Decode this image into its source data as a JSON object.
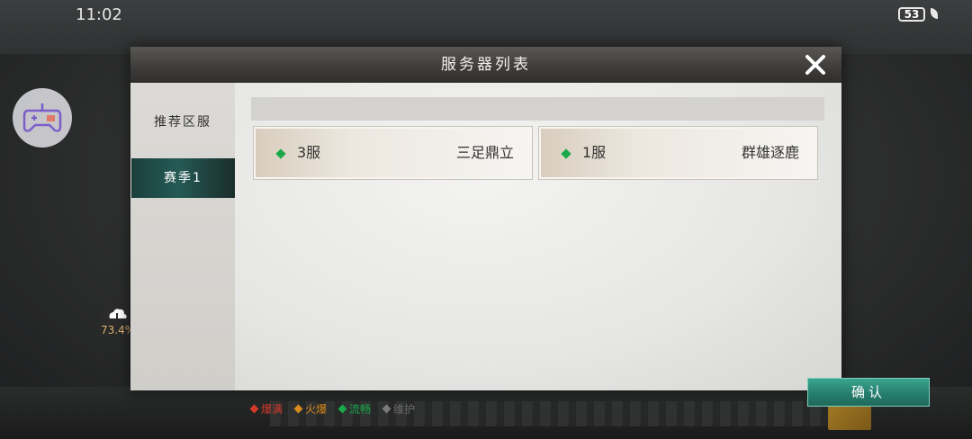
{
  "status_bar": {
    "time": "11:02",
    "battery": "53"
  },
  "dialog": {
    "title": "服务器列表",
    "sidebar": [
      {
        "label": "推荐区服",
        "active": false
      },
      {
        "label": "赛季1",
        "active": true
      }
    ],
    "servers": [
      {
        "name": "3服",
        "desc": "三足鼎立",
        "status": "流畅"
      },
      {
        "name": "1服",
        "desc": "群雄逐鹿",
        "status": "流畅"
      }
    ],
    "legend": [
      {
        "label": "爆满",
        "color": "#d33a2c"
      },
      {
        "label": "火爆",
        "color": "#d88a1c"
      },
      {
        "label": "流畅",
        "color": "#1aa84a"
      },
      {
        "label": "维护",
        "color": "#7a7a7a"
      }
    ],
    "confirm_label": "确认"
  },
  "overlay": {
    "download_progress": "73.4%"
  },
  "icons": {
    "close": "close-icon",
    "gamepad": "gamepad-icon",
    "download": "cloud-download-icon",
    "battery": "battery-icon",
    "leaf": "leaf-icon"
  }
}
